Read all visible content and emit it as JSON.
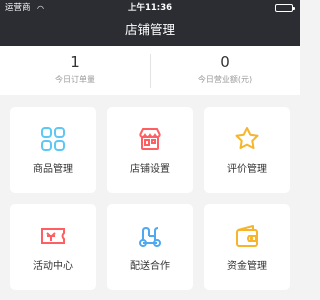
{
  "status_bar": {
    "carrier": "运营商",
    "time": "上午11:36"
  },
  "header": {
    "title": "店铺管理"
  },
  "summary": [
    {
      "value": "1",
      "label": "今日订单量"
    },
    {
      "value": "0",
      "label": "今日营业额(元)"
    }
  ],
  "menu": [
    {
      "label": "商品管理",
      "icon": "product-grid-icon",
      "color": "#5ec8f5"
    },
    {
      "label": "店铺设置",
      "icon": "storefront-icon",
      "color": "#ff5f62"
    },
    {
      "label": "评价管理",
      "icon": "star-icon",
      "color": "#f7b52c"
    },
    {
      "label": "活动中心",
      "icon": "ticket-icon",
      "color": "#ff5f62"
    },
    {
      "label": "配送合作",
      "icon": "scooter-icon",
      "color": "#4ea8f2"
    },
    {
      "label": "资金管理",
      "icon": "wallet-icon",
      "color": "#f7b52c"
    }
  ]
}
